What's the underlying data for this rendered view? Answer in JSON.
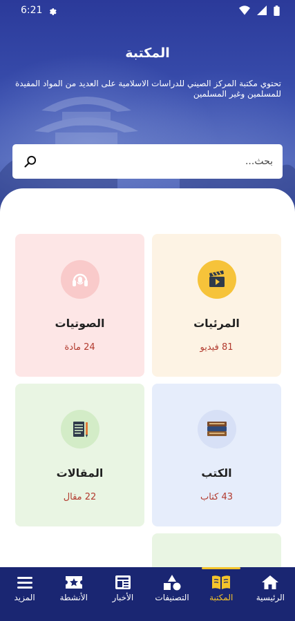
{
  "status": {
    "time": "6:21"
  },
  "header": {
    "title": "المكتبة",
    "description": "تحتوي مكتبة المركز الصيني للدراسات الاسلامية على العديد من المواد المفيدة للمسلمين وغير المسلمين"
  },
  "search": {
    "placeholder": "بحث..."
  },
  "cards": [
    {
      "title": "المرئيات",
      "count": "81 فيديو",
      "icon": "video-clapper-icon",
      "bg": "#fdf3e4",
      "icon_bg": "#f6c33a"
    },
    {
      "title": "الصوتيات",
      "count": "24 مادة",
      "icon": "headphones-icon",
      "bg": "#fde6e6",
      "icon_bg": "#f9caca"
    },
    {
      "title": "الكتب",
      "count": "43 كتاب",
      "icon": "books-icon",
      "bg": "#e6edfb",
      "icon_bg": "#d7e0f6"
    },
    {
      "title": "المقالات",
      "count": "22 مقال",
      "icon": "notepad-icon",
      "bg": "#e9f5e3",
      "icon_bg": "#d3ecc7"
    }
  ],
  "nav": {
    "items": [
      {
        "label": "الرئيسية",
        "icon": "home-icon"
      },
      {
        "label": "المكتبة",
        "icon": "book-icon",
        "active": true
      },
      {
        "label": "التصنيفات",
        "icon": "shapes-icon"
      },
      {
        "label": "الأخبار",
        "icon": "news-icon"
      },
      {
        "label": "الأنشطة",
        "icon": "star-ticket-icon"
      },
      {
        "label": "المزيد",
        "icon": "menu-icon"
      }
    ]
  },
  "colors": {
    "accent": "#f4c42b",
    "nav_bg": "#1a2672",
    "count_text": "#b23a2e"
  }
}
